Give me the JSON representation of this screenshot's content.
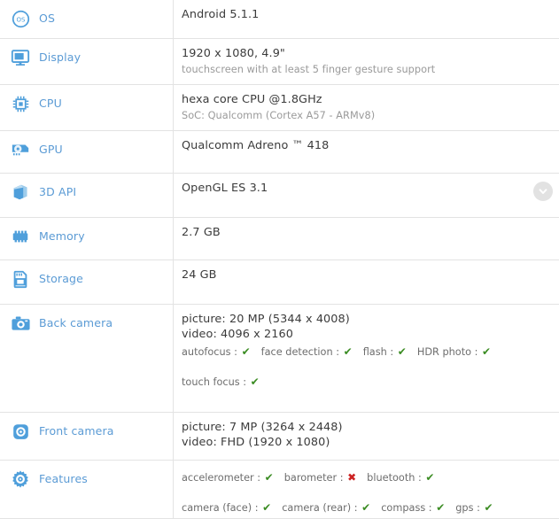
{
  "rows": [
    {
      "icon": "os-icon",
      "label": "OS",
      "main": "Android 5.1.1",
      "sub": ""
    },
    {
      "icon": "display-icon",
      "label": "Display",
      "main": "1920 x 1080, 4.9\"",
      "sub": "touchscreen with at least 5 finger gesture support"
    },
    {
      "icon": "cpu-icon",
      "label": "CPU",
      "main": "hexa core CPU @1.8GHz",
      "sub": "SoC: Qualcomm (Cortex A57 - ARMv8)"
    },
    {
      "icon": "gpu-icon",
      "label": "GPU",
      "main": "Qualcomm Adreno ™ 418",
      "sub": ""
    },
    {
      "icon": "cube-3d-icon",
      "label": "3D API",
      "main": "OpenGL ES 3.1",
      "sub": "",
      "expand_icon": "chevron-down-icon"
    },
    {
      "icon": "memory-icon",
      "label": "Memory",
      "main": "2.7 GB",
      "sub": ""
    },
    {
      "icon": "storage-icon",
      "label": "Storage",
      "main": "24 GB",
      "sub": ""
    },
    {
      "icon": "back-camera-icon",
      "label": "Back camera",
      "main": "picture: 20 MP (5344 x 4008)",
      "main2": "video: 4096 x 2160",
      "features_line1": [
        {
          "name": "autofocus",
          "value": true
        },
        {
          "name": "face detection",
          "value": true
        },
        {
          "name": "flash",
          "value": true
        },
        {
          "name": "HDR photo",
          "value": true
        }
      ],
      "features_line2": [
        {
          "name": "touch focus",
          "value": true
        }
      ]
    },
    {
      "icon": "front-camera-icon",
      "label": "Front camera",
      "main": "picture: 7 MP (3264 x 2448)",
      "main2": "video: FHD (1920 x 1080)"
    },
    {
      "icon": "features-gear-icon",
      "label": "Features",
      "features_line1": [
        {
          "name": "accelerometer",
          "value": true
        },
        {
          "name": "barometer",
          "value": false
        },
        {
          "name": "bluetooth",
          "value": true
        }
      ],
      "features_line2": [
        {
          "name": "camera (face)",
          "value": true
        },
        {
          "name": "camera (rear)",
          "value": true
        },
        {
          "name": "compass",
          "value": true
        },
        {
          "name": "gps",
          "value": true
        }
      ]
    }
  ],
  "symbols": {
    "check": "✔",
    "cross": "✖",
    "separator": ":"
  },
  "colors": {
    "label_blue": "#5b9bd5",
    "icon_blue": "#4f9fdb",
    "check_green": "#3b8c23",
    "cross_red": "#cc2222",
    "border": "#e3e3e3",
    "sub_text": "#9a9a9a",
    "main_text": "#3b3b3b"
  }
}
